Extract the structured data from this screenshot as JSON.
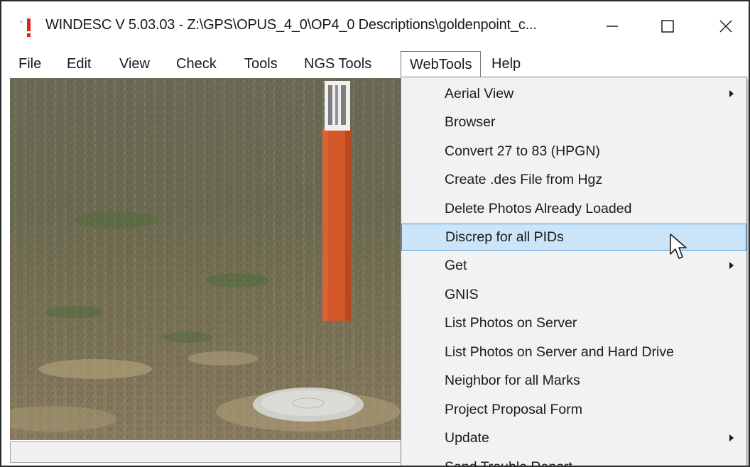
{
  "window": {
    "title": "WINDESC V 5.03.03 - Z:\\GPS\\OPUS_4_0\\OP4_0 Descriptions\\goldenpoint_c...",
    "minimize_icon": "minimize-icon",
    "maximize_icon": "maximize-icon",
    "close_icon": "close-icon"
  },
  "menubar": {
    "items": [
      {
        "label": "File"
      },
      {
        "label": "Edit"
      },
      {
        "label": "View"
      },
      {
        "label": "Check"
      },
      {
        "label": "Tools"
      },
      {
        "label": "NGS Tools"
      },
      {
        "label": "WebTools"
      },
      {
        "label": "Help"
      }
    ],
    "active": "WebTools"
  },
  "webtools_menu": {
    "items": [
      {
        "label": "Aerial View",
        "submenu": true
      },
      {
        "label": "Browser",
        "submenu": false
      },
      {
        "label": "Convert 27 to 83 (HPGN)",
        "submenu": false
      },
      {
        "label": "Create .des File from Hgz",
        "submenu": false
      },
      {
        "label": "Delete Photos Already Loaded",
        "submenu": false
      },
      {
        "label": "Discrep for all PIDs",
        "submenu": false,
        "highlighted": true
      },
      {
        "label": "Get",
        "submenu": true
      },
      {
        "label": "GNIS",
        "submenu": false
      },
      {
        "label": "List Photos on Server",
        "submenu": false
      },
      {
        "label": "List Photos on Server and Hard Drive",
        "submenu": false
      },
      {
        "label": "Neighbor for all Marks",
        "submenu": false
      },
      {
        "label": "Project Proposal Form",
        "submenu": false
      },
      {
        "label": "Update",
        "submenu": true
      },
      {
        "label": "Send Trouble Report",
        "submenu": false
      }
    ]
  },
  "colors": {
    "highlight_bg": "#cce4f7",
    "highlight_border": "#3d8fd6",
    "menu_bg": "#f2f2f2",
    "post_orange": "#d2582a"
  }
}
